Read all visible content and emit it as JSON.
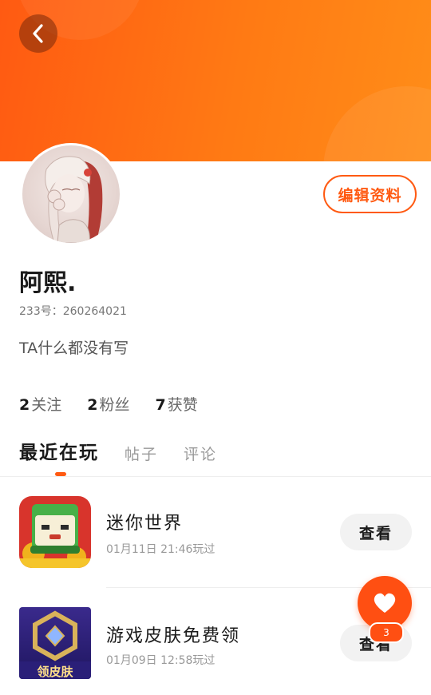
{
  "header": {
    "back_icon": "chevron-left-icon",
    "edit_profile_label": "编辑资料"
  },
  "profile": {
    "username": "阿熙.",
    "uid": "233号：260264021",
    "bio": "TA什么都没有写",
    "stats": [
      {
        "value": "2",
        "label": "关注"
      },
      {
        "value": "2",
        "label": "粉丝"
      },
      {
        "value": "7",
        "label": "获赞"
      }
    ]
  },
  "tabs": [
    {
      "label": "最近在玩",
      "active": true
    },
    {
      "label": "帖子",
      "active": false
    },
    {
      "label": "评论",
      "active": false
    }
  ],
  "games": [
    {
      "name": "迷你世界",
      "played_time": "01月11日  21:46玩过",
      "view_label": "查看",
      "icon": "mini-world-game-icon"
    },
    {
      "name": "游戏皮肤免费领",
      "played_time": "01月09日  12:58玩过",
      "view_label": "查看",
      "icon": "free-skin-game-icon",
      "icon_text": "领皮肤"
    }
  ],
  "fab": {
    "icon": "heart-icon",
    "badge": "3"
  },
  "colors": {
    "accent": "#ff5a12",
    "banner_start": "#ff5a12",
    "banner_end": "#ff8d18"
  }
}
